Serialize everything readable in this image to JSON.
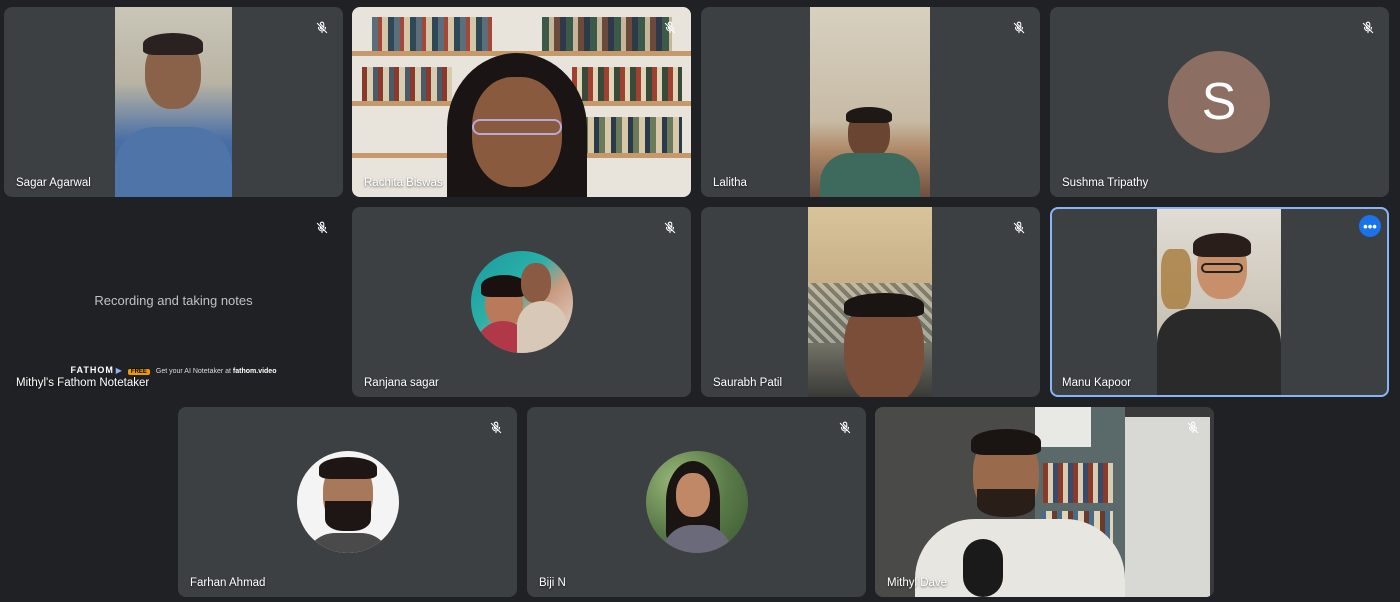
{
  "meeting": {
    "participants": [
      {
        "name": "Sagar Agarwal",
        "muted": true
      },
      {
        "name": "Rachita Biswas",
        "muted": true
      },
      {
        "name": "Lalitha",
        "muted": true
      },
      {
        "name": "Sushma Tripathy",
        "muted": true,
        "avatar_letter": "S"
      },
      {
        "name": "Mithyl's Fathom Notetaker",
        "muted": true
      },
      {
        "name": "Ranjana sagar",
        "muted": true
      },
      {
        "name": "Saurabh Patil",
        "muted": true
      },
      {
        "name": "Manu Kapoor",
        "active": true
      },
      {
        "name": "Farhan Ahmad",
        "muted": true
      },
      {
        "name": "Biji N",
        "muted": true
      },
      {
        "name": "Mithyl Dave",
        "muted": true
      }
    ],
    "notetaker": {
      "status_text": "Recording and taking notes",
      "brand": "FATHOM",
      "badge": "FREE",
      "promo": "Get your AI Notetaker at",
      "url": "fathom.video"
    },
    "more_options_label": "•••"
  },
  "colors": {
    "tile_bg": "#3c4043",
    "page_bg": "#202124",
    "active_border": "#8ab4f8",
    "menu_button": "#1a73e8",
    "avatar_bg": "#8d6e63"
  },
  "icons": {
    "mic_off": "mic-off-icon",
    "more": "more-options-icon"
  }
}
